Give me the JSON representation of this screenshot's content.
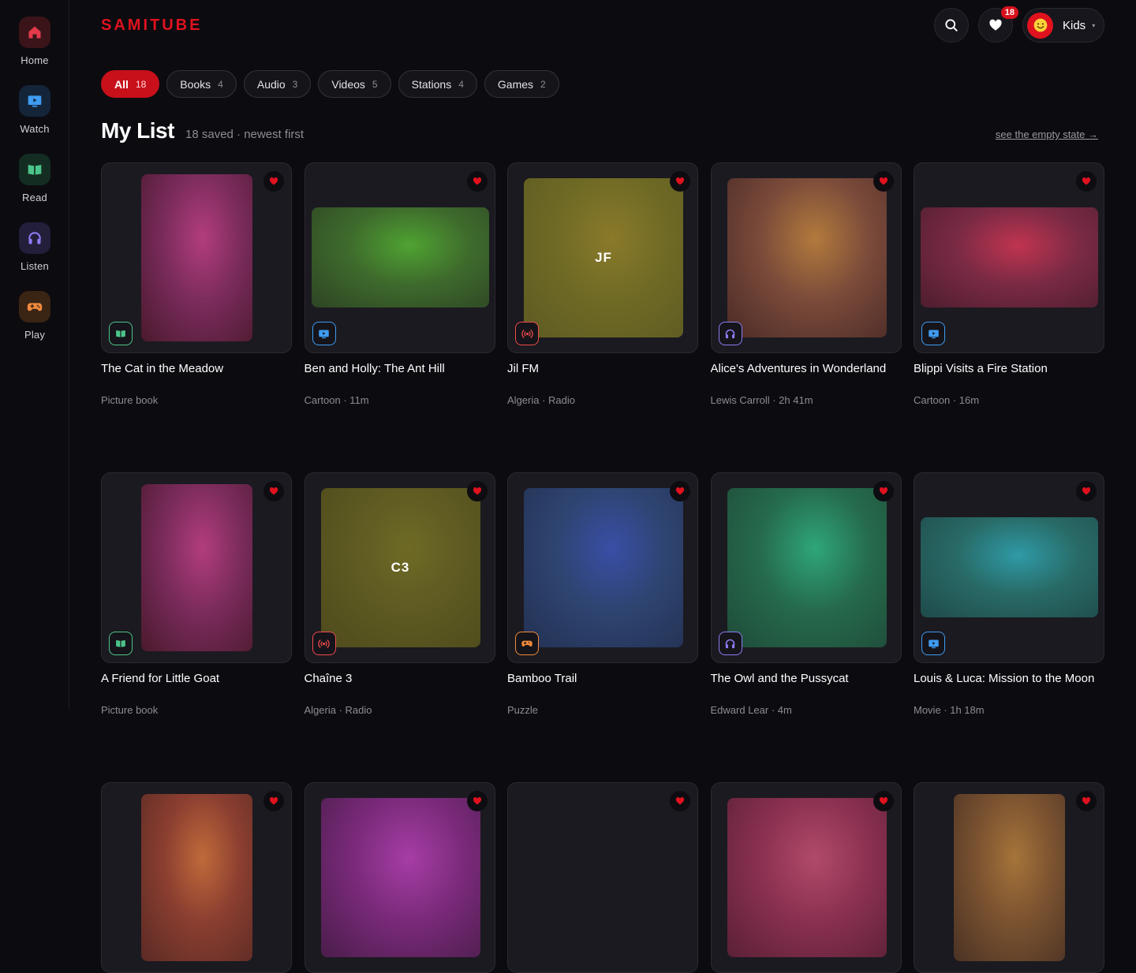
{
  "app": {
    "name": "SAMITUBE"
  },
  "sidebar": {
    "items": [
      {
        "key": "home",
        "label": "Home",
        "icon": "home-icon",
        "color": "#e23a4a",
        "bg": "#3a1419"
      },
      {
        "key": "watch",
        "label": "Watch",
        "icon": "tv-icon",
        "color": "#3e9cf2",
        "bg": "#14253a"
      },
      {
        "key": "read",
        "label": "Read",
        "icon": "book-icon",
        "color": "#4cc58a",
        "bg": "#142d22"
      },
      {
        "key": "listen",
        "label": "Listen",
        "icon": "headphones-icon",
        "color": "#8d7cf3",
        "bg": "#231e3a"
      },
      {
        "key": "play",
        "label": "Play",
        "icon": "gamepad-icon",
        "color": "#f08a3c",
        "bg": "#3a2414"
      }
    ]
  },
  "header": {
    "favorites_count": "18",
    "profile_name": "Kids",
    "profile_caret": "▾"
  },
  "filters": [
    {
      "label": "All",
      "count": "18",
      "active": true
    },
    {
      "label": "Books",
      "count": "4"
    },
    {
      "label": "Audio",
      "count": "3"
    },
    {
      "label": "Videos",
      "count": "5"
    },
    {
      "label": "Stations",
      "count": "4"
    },
    {
      "label": "Games",
      "count": "2"
    }
  ],
  "list": {
    "title": "My List",
    "subtitle": "18 saved · newest first",
    "empty_link": "see the empty state →"
  },
  "colors": {
    "accent": "#e0121e",
    "book": "#4cc58a",
    "video": "#3e9cf2",
    "radio": "#ef4b4b",
    "audio": "#8d7cf3",
    "game": "#f08a3c"
  },
  "cards": [
    {
      "title": "The Cat in the Meadow",
      "meta": "Picture book",
      "type": "book",
      "shape": "book",
      "art": [
        "#b23d7e",
        "#7a2b5c",
        "#4a1a2c"
      ],
      "art_text": ""
    },
    {
      "title": "Ben and Holly: The Ant Hill",
      "meta": "Cartoon · 11m",
      "type": "video",
      "shape": "video",
      "art": [
        "#4fa332",
        "#3e6a2c",
        "#2d4424"
      ],
      "art_text": ""
    },
    {
      "title": "Jil FM",
      "meta": "Algeria · Radio",
      "type": "radio",
      "shape": "square",
      "art": [
        "#8a7a2a",
        "#6f6a25",
        "#5d5a22"
      ],
      "art_text": "JF"
    },
    {
      "title": "Alice's Adventures in Wonderland",
      "meta": "Lewis Carroll · 2h 41m",
      "type": "audio",
      "shape": "square",
      "art": [
        "#b27a3c",
        "#7a4a3a",
        "#4a2a26"
      ],
      "art_text": ""
    },
    {
      "title": "Blippi Visits a Fire Station",
      "meta": "Cartoon · 16m",
      "type": "video",
      "shape": "video",
      "art": [
        "#c03450",
        "#7a2a44",
        "#4d1d2e"
      ],
      "art_text": ""
    },
    {
      "title": "A Friend for Little Goat",
      "meta": "Picture book",
      "type": "book",
      "shape": "book",
      "art": [
        "#b23d7e",
        "#7a2b5c",
        "#4a1a2c"
      ],
      "art_text": ""
    },
    {
      "title": "Chaîne 3",
      "meta": "Algeria · Radio",
      "type": "radio",
      "shape": "square",
      "art": [
        "#6e6a25",
        "#5e5a22",
        "#4e4a1c"
      ],
      "art_text": "C3"
    },
    {
      "title": "Bamboo Trail",
      "meta": "Puzzle",
      "type": "game",
      "shape": "square",
      "art": [
        "#3a4ea6",
        "#2e4470",
        "#233052"
      ],
      "art_text": ""
    },
    {
      "title": "The Owl and the Pussycat",
      "meta": "Edward Lear · 4m",
      "type": "audio",
      "shape": "square",
      "art": [
        "#2fa67a",
        "#256a4c",
        "#1f4a38"
      ],
      "art_text": ""
    },
    {
      "title": "Louis & Luca: Mission to the Moon",
      "meta": "Movie · 1h 18m",
      "type": "video",
      "shape": "video",
      "art": [
        "#2f9aa6",
        "#286a66",
        "#1f4a4a"
      ],
      "art_text": ""
    },
    {
      "title": "",
      "meta": "",
      "type": "",
      "shape": "book",
      "art": [
        "#c06a3a",
        "#8a3e30",
        "#5a2a24"
      ],
      "art_text": ""
    },
    {
      "title": "",
      "meta": "",
      "type": "",
      "shape": "square",
      "art": [
        "#a63da6",
        "#7a2a7a",
        "#4a1d4a"
      ],
      "art_text": ""
    },
    {
      "title": "",
      "meta": "",
      "type": "",
      "shape": "none",
      "art": [],
      "art_text": ""
    },
    {
      "title": "",
      "meta": "",
      "type": "",
      "shape": "square",
      "art": [
        "#b24a6a",
        "#8a3050",
        "#5a2036"
      ],
      "art_text": ""
    },
    {
      "title": "",
      "meta": "",
      "type": "",
      "shape": "book",
      "art": [
        "#a6743a",
        "#7a5230",
        "#4a3224"
      ],
      "art_text": ""
    }
  ]
}
